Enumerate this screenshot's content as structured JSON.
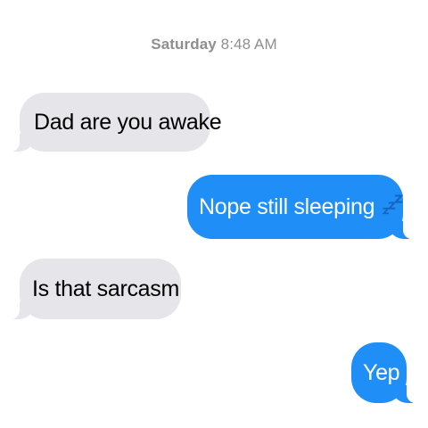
{
  "conversation": {
    "timestamp": {
      "day": "Saturday",
      "time": "8:48 AM"
    },
    "messages": [
      {
        "direction": "incoming",
        "text": "Dad are you awake"
      },
      {
        "direction": "outgoing",
        "text": "Nope still sleeping",
        "emoji": "sleeping-zzz-icon"
      },
      {
        "direction": "incoming",
        "text": "Is that sarcasm"
      },
      {
        "direction": "outgoing",
        "text": "Yep"
      }
    ]
  },
  "colors": {
    "incoming_bubble": "#e5e5ea",
    "outgoing_bubble": "#1f8ff7",
    "timestamp_text": "#8e8e93",
    "zzz_emoji": "#1565c0"
  }
}
